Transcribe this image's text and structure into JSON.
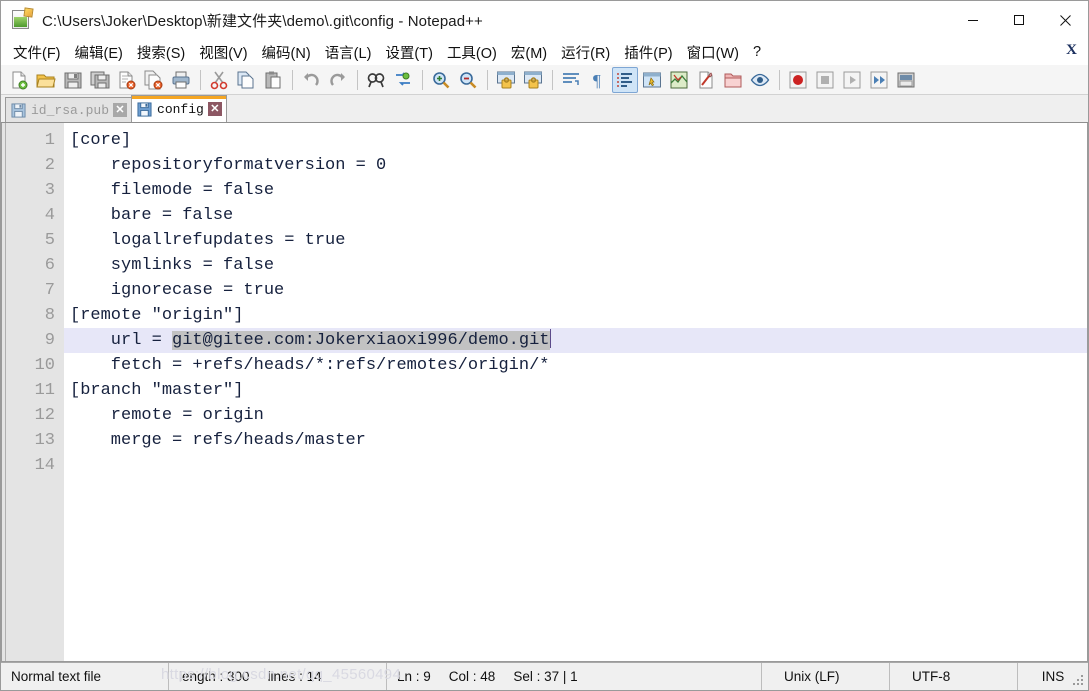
{
  "window": {
    "title": "C:\\Users\\Joker\\Desktop\\新建文件夹\\demo\\.git\\config - Notepad++",
    "app_icon": "notepad-plus-plus-icon",
    "controls": {
      "minimize": "minimize-icon",
      "maximize": "maximize-icon",
      "close": "close-icon"
    }
  },
  "menu": {
    "items": [
      {
        "label": "文件(F)",
        "name": "menu-file"
      },
      {
        "label": "编辑(E)",
        "name": "menu-edit"
      },
      {
        "label": "搜索(S)",
        "name": "menu-search"
      },
      {
        "label": "视图(V)",
        "name": "menu-view"
      },
      {
        "label": "编码(N)",
        "name": "menu-encoding"
      },
      {
        "label": "语言(L)",
        "name": "menu-language"
      },
      {
        "label": "设置(T)",
        "name": "menu-settings"
      },
      {
        "label": "工具(O)",
        "name": "menu-tools"
      },
      {
        "label": "宏(M)",
        "name": "menu-macro"
      },
      {
        "label": "运行(R)",
        "name": "menu-run"
      },
      {
        "label": "插件(P)",
        "name": "menu-plugins"
      },
      {
        "label": "窗口(W)",
        "name": "menu-window"
      },
      {
        "label": "?",
        "name": "menu-help"
      }
    ],
    "close_document_label": "X"
  },
  "toolbar": {
    "buttons": [
      "new-file-icon",
      "open-file-icon",
      "save-icon",
      "save-all-icon",
      "close-file-icon",
      "close-all-icon",
      "print-icon",
      "sep",
      "cut-icon",
      "copy-icon",
      "paste-icon",
      "sep",
      "undo-icon",
      "redo-icon",
      "sep",
      "find-icon",
      "replace-icon",
      "sep",
      "zoom-in-icon",
      "zoom-out-icon",
      "sep",
      "sync-vertical-scroll-icon",
      "sync-horizontal-scroll-icon",
      "sep",
      "word-wrap-icon",
      "show-all-characters-icon",
      "show-indent-guide-icon",
      "user-defined-language-icon",
      "document-map-icon",
      "function-list-icon",
      "folder-as-workspace-icon",
      "monitoring-icon",
      "sep",
      "macro-record-icon",
      "macro-stop-icon",
      "macro-play-icon",
      "macro-run-multiple-icon",
      "macro-save-icon"
    ],
    "active_button": "show-indent-guide-icon"
  },
  "tabs": [
    {
      "label": "id_rsa.pub",
      "active": false,
      "icon": "saved-file-icon",
      "close": "tab-close-icon"
    },
    {
      "label": "config",
      "active": true,
      "icon": "saved-file-icon",
      "close": "tab-close-icon"
    }
  ],
  "editor": {
    "line_numbers": [
      "1",
      "2",
      "3",
      "4",
      "5",
      "6",
      "7",
      "8",
      "9",
      "10",
      "11",
      "12",
      "13",
      "14"
    ],
    "lines": [
      {
        "text": "[core]"
      },
      {
        "text": "    repositoryformatversion = 0"
      },
      {
        "text": "    filemode = false"
      },
      {
        "text": "    bare = false"
      },
      {
        "text": "    logallrefupdates = true"
      },
      {
        "text": "    symlinks = false"
      },
      {
        "text": "    ignorecase = true"
      },
      {
        "text": "[remote \"origin\"]"
      },
      {
        "text": "    url = git@gitee.com:Jokerxiaoxi996/demo.git",
        "current": true,
        "prefix": "    url = ",
        "selected": "git@gitee.com:Jokerxiaoxi996/demo.git"
      },
      {
        "text": "    fetch = +refs/heads/*:refs/remotes/origin/*"
      },
      {
        "text": "[branch \"master\"]"
      },
      {
        "text": "    remote = origin"
      },
      {
        "text": "    merge = refs/heads/master"
      },
      {
        "text": ""
      }
    ],
    "current_line_color": "#e7e7f8",
    "selection_color": "#c2c2c2",
    "text_color": "#16213e",
    "gutter_color": "#e4e4e4"
  },
  "statusbar": {
    "doc_type": "Normal text file",
    "length_label": "length : 300",
    "lines_label": "lines : 14",
    "ln": "Ln : 9",
    "col": "Col : 48",
    "sel": "Sel : 37 | 1",
    "eol": "Unix (LF)",
    "encoding": "UTF-8",
    "insert_mode": "INS",
    "watermark": "https://blog.csdn.net/qq_45560494"
  }
}
